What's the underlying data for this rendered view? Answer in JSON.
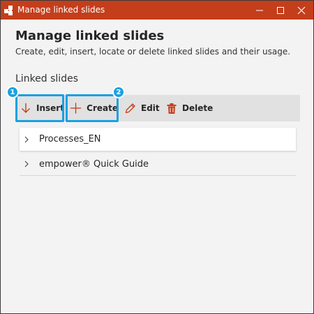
{
  "window": {
    "title": "Manage linked slides",
    "accent_color": "#c43e1c",
    "controls": [
      "minimize-icon",
      "maximize-icon",
      "close-icon"
    ]
  },
  "main": {
    "heading": "Manage linked slides",
    "subheading": "Create, edit, insert, locate or delete linked slides and their usage.",
    "section_label": "Linked slides"
  },
  "toolbar": {
    "insert_label": "Insert",
    "create_label": "Create",
    "edit_label": "Edit",
    "delete_label": "Delete",
    "icons": [
      "arrow-down-icon",
      "plus-icon",
      "pencil-icon",
      "trash-icon"
    ]
  },
  "callouts": {
    "badge_1": "1",
    "badge_2": "2",
    "highlight_color": "#1ba1e2"
  },
  "linked_slides": [
    {
      "label": "Processes_EN"
    },
    {
      "label": "empower® Quick Guide"
    }
  ]
}
